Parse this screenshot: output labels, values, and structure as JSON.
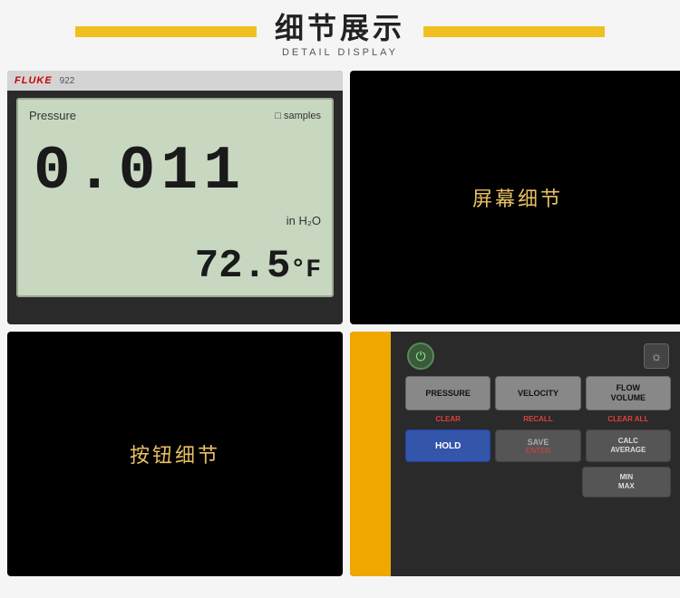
{
  "header": {
    "title_cn": "细节展示",
    "title_en": "DETAIL DISPLAY",
    "bar_color": "#f0c020"
  },
  "lcd_panel": {
    "logo": "FLUKE",
    "model": "922",
    "label_pressure": "Pressure",
    "samples_icon": "□",
    "samples_text": "samples",
    "main_value": "0.011",
    "unit": "in H₂O",
    "sub_value": "72.5",
    "sub_unit": "°F"
  },
  "screen_detail": {
    "text": "屏幕细节"
  },
  "btn_detail": {
    "text": "按钮细节"
  },
  "keypad": {
    "power_icon": "⏻",
    "backlight_icon": "☼",
    "buttons": {
      "row1": [
        {
          "main": "PRESSURE",
          "sub": "CLEAR",
          "type": "main"
        },
        {
          "main": "VELOCITY",
          "sub": "RECALL",
          "type": "main"
        },
        {
          "main": "FLOW\nVOLUME",
          "sub": "CLEAR ALL",
          "type": "main"
        }
      ],
      "row2_labels": [
        "CLEAR",
        "RECALL",
        "CLEAR ALL"
      ],
      "row2": [
        {
          "main": "HOLD",
          "sub": "",
          "type": "blue"
        },
        {
          "main": "SAVE\nENTER",
          "sub": "",
          "type": "dark"
        },
        {
          "main": "CALC\nAVERAGE",
          "sub": "",
          "type": "dark-sm"
        }
      ],
      "row3": [
        {
          "main": "",
          "type": "empty"
        },
        {
          "main": "",
          "type": "empty"
        },
        {
          "main": "MIN\nMAX",
          "type": "dark-sm"
        }
      ]
    }
  }
}
